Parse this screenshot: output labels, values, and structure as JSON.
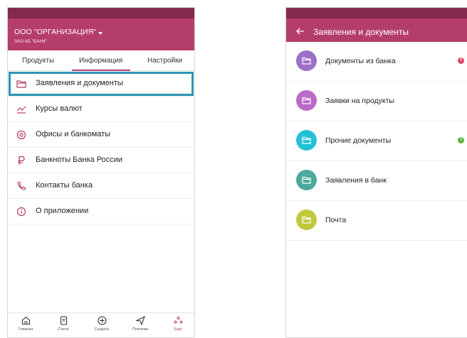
{
  "left_screen": {
    "org": {
      "name": "ООО \"ОРГАНИЗАЦИЯ\"",
      "bank": "ЗАО КБ \"БАНК\""
    },
    "tabs": [
      {
        "label": "Продукты"
      },
      {
        "label": "Информация",
        "active": true
      },
      {
        "label": "Настройки"
      }
    ],
    "menu": [
      {
        "label": "Заявления и документы",
        "icon": "folder-icon",
        "selected": true
      },
      {
        "label": "Курсы валют",
        "icon": "chart-line-icon"
      },
      {
        "label": "Офисы и банкоматы",
        "icon": "location-pin-icon"
      },
      {
        "label": "Банкноты Банка России",
        "icon": "ruble-icon"
      },
      {
        "label": "Контакты банка",
        "icon": "phone-icon"
      },
      {
        "label": "О приложении",
        "icon": "info-icon"
      }
    ],
    "bottom_nav": [
      {
        "label": "Главная",
        "icon": "home-icon"
      },
      {
        "label": "Счета",
        "icon": "document-icon"
      },
      {
        "label": "Создать",
        "icon": "plus-circle-icon"
      },
      {
        "label": "Платежи",
        "icon": "send-icon"
      },
      {
        "label": "Ещё",
        "icon": "more-dots-icon",
        "active": true
      }
    ]
  },
  "right_screen": {
    "title": "Заявления и документы",
    "back_icon": "arrow-left-icon",
    "items": [
      {
        "label": "Документы из банка",
        "color": "#9c6fc9",
        "badge": "4",
        "badge_color": "#e0455b"
      },
      {
        "label": "Заявки на продукты",
        "color": "#ba6ac9",
        "badge": null
      },
      {
        "label": "Прочие документы",
        "color": "#23c1d6",
        "badge": "3",
        "badge_color": "#5ab23c"
      },
      {
        "label": "Заявления в банк",
        "color": "#4aab9c",
        "badge": null
      },
      {
        "label": "Почта",
        "color": "#c1c83d",
        "badge": null
      }
    ]
  },
  "colors": {
    "brand": "#b53d6c",
    "brand_dark": "#86294f",
    "highlight": "#2b95b0"
  }
}
